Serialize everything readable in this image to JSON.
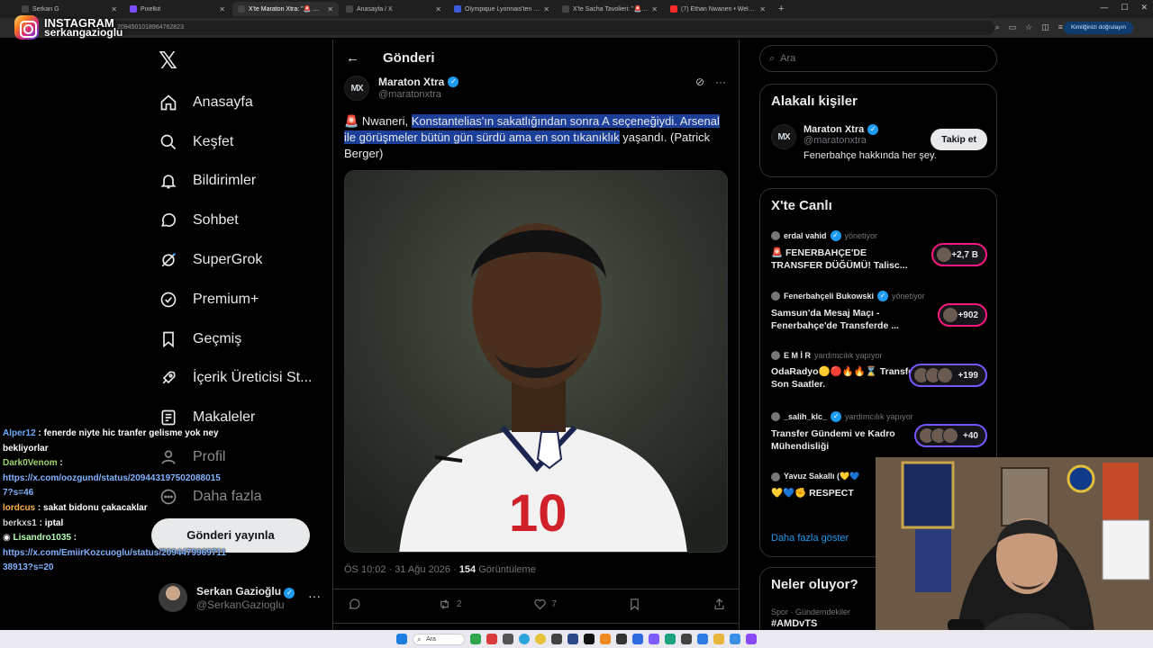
{
  "browser": {
    "tabs": [
      {
        "label": "Serkan G",
        "color": "#444"
      },
      {
        "label": "Pixelkit",
        "color": "#7b4dff"
      },
      {
        "label": "X'te Maraton Xtra: \"🚨 Nwaneri",
        "color": "#444"
      },
      {
        "label": "Anasayfa / X",
        "color": "#444"
      },
      {
        "label": "Olympique Lyonnais'ten Fenerb",
        "color": "#3b5bdb"
      },
      {
        "label": "X'te Sacha Tavolieri: \"🚨 Exclu",
        "color": "#444"
      },
      {
        "label": "(7) Ethan Nwaneri • Welcome",
        "color": "#ff2a2a"
      }
    ],
    "url": "2094501018964762823",
    "verify_label": "Kimliğinizi doğrulayın"
  },
  "overlay": {
    "ig_title": "INSTAGRAM",
    "ig_handle": "serkangazioglu"
  },
  "nav": {
    "items": [
      {
        "label": "Anasayfa",
        "icon": "home-icon"
      },
      {
        "label": "Keşfet",
        "icon": "search-icon"
      },
      {
        "label": "Bildirimler",
        "icon": "bell-icon"
      },
      {
        "label": "Sohbet",
        "icon": "chat-icon"
      },
      {
        "label": "SuperGrok",
        "icon": "grok-icon"
      },
      {
        "label": "Premium+",
        "icon": "premium-icon"
      },
      {
        "label": "Geçmiş",
        "icon": "bookmark-icon"
      },
      {
        "label": "İçerik Üreticisi St...",
        "icon": "rocket-icon"
      },
      {
        "label": "Makaleler",
        "icon": "article-icon"
      },
      {
        "label": "Profil",
        "icon": "profile-icon"
      },
      {
        "label": "Daha fazla",
        "icon": "more-icon"
      }
    ],
    "post_button": "Gönderi yayınla",
    "account_name": "Serkan Gazioğlu",
    "account_handle": "@SerkanGazioglu"
  },
  "chat": [
    {
      "user": "Alper12",
      "text": ": fenerde niyte hic tranfer gelisme yok ney bekliyorlar"
    },
    {
      "user": "Dark0Venom",
      "text": ":",
      "link": "https://x.com/oozgund/status/2094431975020880157?s=46"
    },
    {
      "user": "lordcus",
      "text": ": sakat bidonu çakacaklar"
    },
    {
      "user": "berkxs1",
      "text": ": iptal"
    },
    {
      "user": "Lisandro1035",
      "text": ":",
      "link": "https://x.com/EmiirKozcuoglu/status/209447996971138913?s=20"
    }
  ],
  "post": {
    "header": "Gönderi",
    "author_name": "Maraton Xtra",
    "author_handle": "@maratonxtra",
    "avatar_text": "MX",
    "text_plain": "Nwaneri, ",
    "text_highlight": "Konstantelias'ın sakatlığından sonra A seçeneğiydi. Arsenal ile görüşmeler bütün gün sürdü ama en son tıkanıklık",
    "text_tail": " yaşandı. (Patrick Berger)",
    "meta_time": "ÖS 10:02 · 31 Ağu 2026 · ",
    "views": "154",
    "views_label": "Görüntüleme",
    "replies": "",
    "reposts": "2",
    "likes": "7"
  },
  "right": {
    "search_placeholder": "Ara",
    "related_title": "Alakalı kişiler",
    "related": {
      "name": "Maraton Xtra",
      "handle": "@maratonxtra",
      "bio": "Fenerbahçe hakkında her şey.",
      "follow": "Takip et"
    },
    "live_title": "X'te Canlı",
    "live": [
      {
        "host": "erdal vahid",
        "role": "yönetiyor",
        "title": "🚨 FENERBAHÇE'DE TRANSFER DÜĞÜMÜ! Talisc...",
        "count": "+2,7 B",
        "ring": "#f91880"
      },
      {
        "host": "Fenerbahçeli Bukowski",
        "role": "yönetiyor",
        "title": "Samsun'da Mesaj Maçı - Fenerbahçe'de Transferde ...",
        "count": "+902",
        "ring": "#f91880"
      },
      {
        "host": "E M İ R",
        "role": "yardımcılık yapıyor",
        "title": "OdaRadyo🟡🔴🔥🔥⌛ Transfer Son Saatler.",
        "count": "+199",
        "ring": "#7856ff"
      },
      {
        "host": "_salih_klc_",
        "role": "yardımcılık yapıyor",
        "title": "Transfer Gündemi ve Kadro Mühendisliği",
        "count": "+40",
        "ring": "#7856ff"
      },
      {
        "host": "Yavuz Sakallı (💛💙",
        "role": "",
        "title": "💛💙✊ RESPECT",
        "count": "",
        "ring": "#7856ff"
      }
    ],
    "show_more": "Daha fazla göster",
    "whats_happening": "Neler oluyor?",
    "trend_context": "Spor · Gündemdekiler",
    "trend_tag": "#AMDvTS"
  },
  "taskbar": {
    "search_label": "Ara"
  }
}
